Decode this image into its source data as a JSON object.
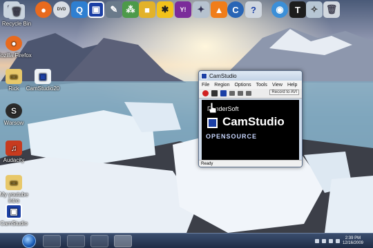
{
  "desktop_icons": [
    {
      "name": "recycle-bin",
      "label": "Recycle Bin"
    },
    {
      "name": "mozilla-firefox",
      "label": "Mozilla Firefox"
    },
    {
      "name": "rick",
      "label": "Rick"
    },
    {
      "name": "camstudio20",
      "label": "CamStudio20"
    },
    {
      "name": "warsow",
      "label": "Warsow"
    },
    {
      "name": "audacity",
      "label": "Audacity"
    },
    {
      "name": "my-youtube-intro",
      "label": "My youtube intro"
    },
    {
      "name": "camstudio",
      "label": "CamStudio"
    }
  ],
  "window": {
    "title": "CamStudio",
    "menu": [
      "File",
      "Region",
      "Options",
      "Tools",
      "View",
      "Help"
    ],
    "record_to": "Record to AVI",
    "splash_brand": "RenderSoft",
    "splash_product": "CamStudio",
    "splash_tag": "OPENSOURCE",
    "status": "Ready"
  },
  "taskbar": {
    "time": "2:39 PM",
    "date": "12/16/2009"
  },
  "colors": {
    "accent": "#1b3fa5",
    "record": "#d02020"
  }
}
